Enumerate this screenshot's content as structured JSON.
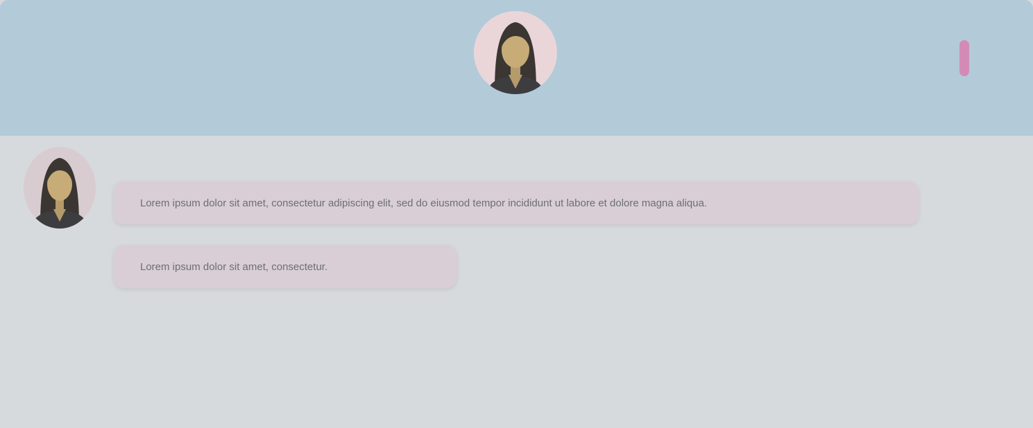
{
  "header": {
    "contact_name": "",
    "avatar_icon": "woman-avatar-icon",
    "menu_icon": "kebab-menu-icon",
    "accent_color": "#d38bb6",
    "background_color": "#b3cad9"
  },
  "chat": {
    "date_separator": "",
    "sender_name": "",
    "sender_color": "#e57db0",
    "bubble_color": "#d9ced6",
    "messages": [
      {
        "text": "Lorem ipsum dolor sit amet, consectetur adipiscing elit, sed do eiusmod tempor incididunt ut labore et dolore magna aliqua."
      },
      {
        "text": "Lorem ipsum dolor sit amet, consectetur."
      }
    ]
  }
}
